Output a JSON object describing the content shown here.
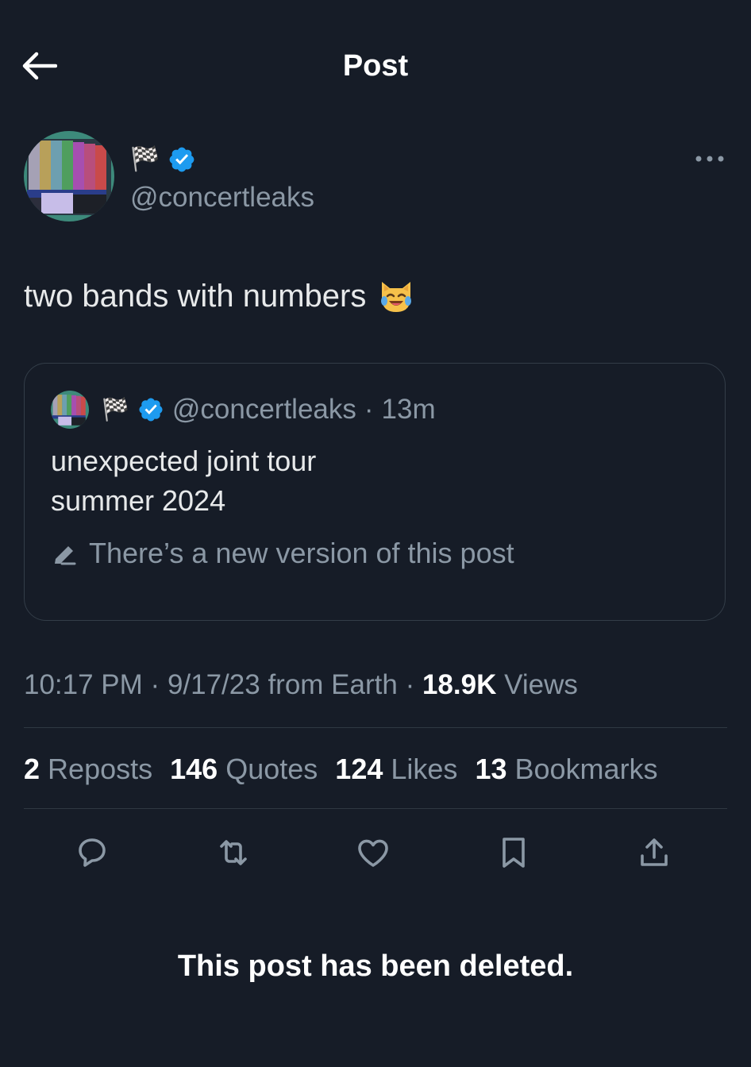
{
  "header": {
    "title": "Post",
    "back_icon": "arrow-left-icon"
  },
  "author": {
    "flag": "🏁",
    "handle": "@concertleaks",
    "verified_icon": "verified-badge-icon",
    "more_icon": "more-horizontal-icon"
  },
  "post": {
    "text": "two bands with numbers",
    "emoji": "cat-face-with-tears-of-joy"
  },
  "quote": {
    "flag": "🏁",
    "handle": "@concertleaks",
    "separator": "·",
    "time": "13m",
    "line1": "unexpected joint tour",
    "line2": "summer 2024",
    "edit_notice": "There’s a new version of this post",
    "edit_icon": "pencil-icon"
  },
  "meta": {
    "time": "10:17 PM",
    "date": "9/17/23",
    "source": "from Earth",
    "views_count": "18.9K",
    "views_label": "Views",
    "separator": "·"
  },
  "stats": [
    {
      "count": "2",
      "label": "Reposts"
    },
    {
      "count": "146",
      "label": "Quotes"
    },
    {
      "count": "124",
      "label": "Likes"
    },
    {
      "count": "13",
      "label": "Bookmarks"
    }
  ],
  "actions": [
    "reply-icon",
    "repost-icon",
    "like-icon",
    "bookmark-icon",
    "share-icon"
  ],
  "deleted_notice": "This post has been deleted.",
  "colors": {
    "background": "#161c27",
    "text": "#e7e9ea",
    "secondary": "#8b98a5",
    "verified": "#1d9bf0",
    "border": "#333d48"
  }
}
